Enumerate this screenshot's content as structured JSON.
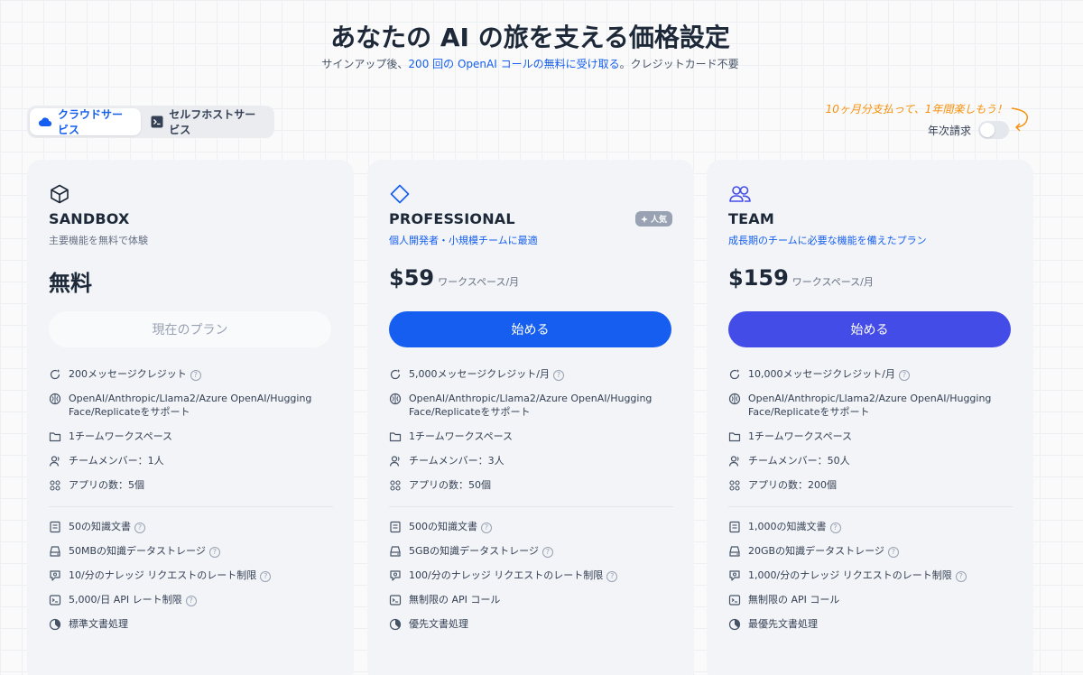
{
  "header": {
    "title": "あなたの AI の旅を支える価格設定",
    "subtitle_prefix": "サインアップ後、",
    "subtitle_highlight": "200 回の OpenAI コールの無料に受け取る",
    "subtitle_suffix": "。クレジットカード不要"
  },
  "tabs": [
    {
      "label": "クラウドサービス",
      "active": true,
      "icon": "cloud-icon"
    },
    {
      "label": "セルフホストサービス",
      "active": false,
      "icon": "terminal-icon"
    }
  ],
  "billing": {
    "promo": "10ヶ月分支払って、1年間楽しもう！",
    "yearly_label": "年次請求",
    "yearly_on": false
  },
  "plans": [
    {
      "name": "SANDBOX",
      "icon": "cube-icon",
      "desc": "主要機能を無料で体験",
      "price": "無料",
      "cta": "現在のプラン",
      "features_main": [
        "200メッセージクレジット",
        "OpenAI/Anthropic/Llama2/Azure OpenAI/Hugging Face/Replicateをサポート",
        "1チームワークスペース",
        "チームメンバー：1人",
        "アプリの数：5個"
      ],
      "features_knowledge": [
        "50の知識文書",
        "50MBの知識データストレージ",
        "10/分のナレッジ リクエストのレート制限",
        "5,000/日 API レート制限",
        "標準文書処理"
      ]
    },
    {
      "name": "PROFESSIONAL",
      "icon": "diamond-icon",
      "desc": "個人開発者・小規模チームに最適",
      "badge": "人気",
      "price": "$59",
      "unit": "ワークスペース/月",
      "cta": "始める",
      "features_main": [
        "5,000メッセージクレジット/月",
        "OpenAI/Anthropic/Llama2/Azure OpenAI/Hugging Face/Replicateをサポート",
        "1チームワークスペース",
        "チームメンバー：3人",
        "アプリの数：50個"
      ],
      "features_knowledge": [
        "500の知識文書",
        "5GBの知識データストレージ",
        "100/分のナレッジ リクエストのレート制限",
        "無制限の API コール",
        "優先文書処理"
      ]
    },
    {
      "name": "TEAM",
      "icon": "users-icon",
      "desc": "成長期のチームに必要な機能を備えたプラン",
      "price": "$159",
      "unit": "ワークスペース/月",
      "cta": "始める",
      "features_main": [
        "10,000メッセージクレジット/月",
        "OpenAI/Anthropic/Llama2/Azure OpenAI/Hugging Face/Replicateをサポート",
        "1チームワークスペース",
        "チームメンバー：50人",
        "アプリの数：200個"
      ],
      "features_knowledge": [
        "1,000の知識文書",
        "20GBの知識データストレージ",
        "1,000/分のナレッジ リクエストのレート制限",
        "無制限の API コール",
        "最優先文書処理"
      ]
    }
  ],
  "help_marker": "?",
  "colors": {
    "primary": "#155eef",
    "team": "#444ce7",
    "promo": "#f79009"
  }
}
